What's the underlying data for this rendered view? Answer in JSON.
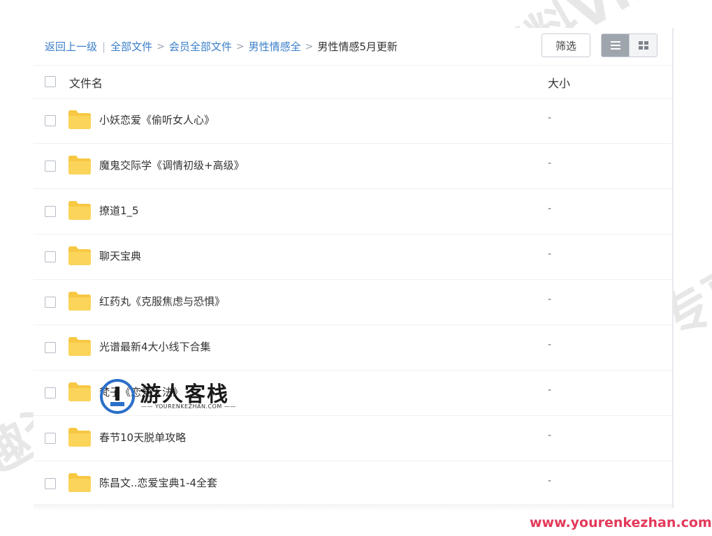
{
  "breadcrumb": {
    "back": "返回上一级",
    "divider": "|",
    "items": [
      "全部文件",
      "会员全部文件",
      "男性情感全"
    ],
    "arrow": ">",
    "current": "男性情感5月更新"
  },
  "toolbar": {
    "filter_label": "筛选",
    "view_modes": [
      "list-view-icon",
      "grid-view-icon"
    ],
    "active_view": "list"
  },
  "table": {
    "col_name": "文件名",
    "col_size": "大小",
    "rows": [
      {
        "name": "小妖恋爱《偷听女人心》",
        "size": "-"
      },
      {
        "name": "魔鬼交际学《调情初级+高级》",
        "size": "-"
      },
      {
        "name": "撩道1_5",
        "size": "-"
      },
      {
        "name": "聊天宝典",
        "size": "-"
      },
      {
        "name": "红药丸《克服焦虑与恐惧》",
        "size": "-"
      },
      {
        "name": "光谱最新4大小线下合集",
        "size": "-"
      },
      {
        "name": "梵子《恋爱大法》",
        "size": "-"
      },
      {
        "name": "春节10天脱单攻略",
        "size": "-"
      },
      {
        "name": "陈昌文..恋爱宝典1-4全套",
        "size": "-"
      }
    ]
  },
  "watermark": {
    "text": "趣资料VIP专享",
    "logo_text": "游人客栈",
    "logo_sub": "—— YOURENKEZHAN.COM ——",
    "url": "www.yourenkezhan.com"
  },
  "colors": {
    "link": "#3a7ec9",
    "folder": "#f7c843",
    "url_red": "#e33a5a"
  }
}
